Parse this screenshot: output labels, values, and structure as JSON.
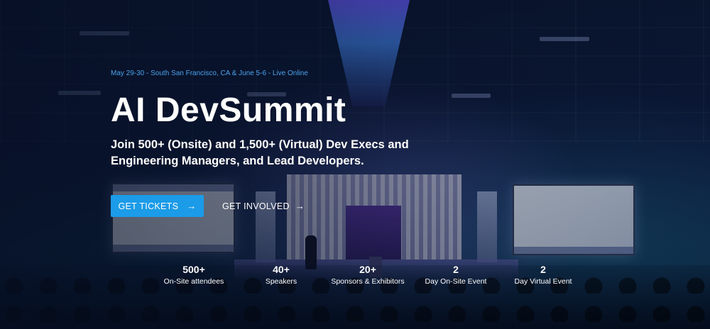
{
  "hero": {
    "eyebrow": "May 29-30 - South San Francisco, CA & June 5-6 - Live Online",
    "title": "AI DevSummit",
    "subtitle": "Join 500+ (Onsite) and 1,500+ (Virtual) Dev Execs and Engineering Managers, and Lead Developers.",
    "buttons": {
      "primary_label": "GET TICKETS",
      "secondary_label": "GET INVOLVED",
      "arrow_icon": "arrow-right-icon"
    },
    "stats": [
      {
        "value": "500+",
        "label": "On-Site attendees"
      },
      {
        "value": "40+",
        "label": "Speakers"
      },
      {
        "value": "20+",
        "label": "Sponsors & Exhibitors"
      },
      {
        "value": "2",
        "label": "Day On-Site Event"
      },
      {
        "value": "2",
        "label": "Day Virtual Event"
      }
    ]
  },
  "colors": {
    "accent": "#1b9be8",
    "eyebrow": "#4aa3ea",
    "background": "#06122a",
    "text": "#ffffff"
  }
}
